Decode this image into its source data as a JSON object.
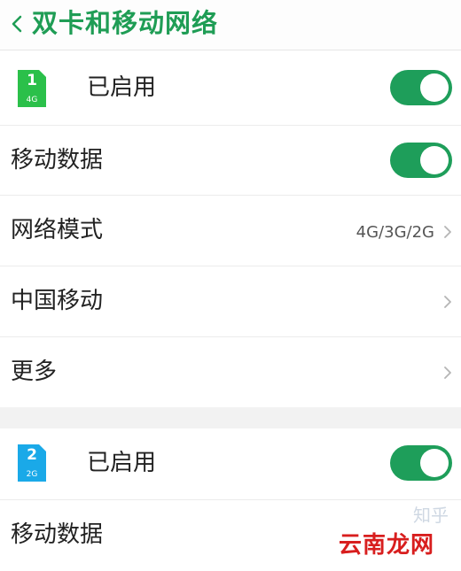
{
  "header": {
    "title": "双卡和移动网络"
  },
  "sim1": {
    "icon": {
      "number": "1",
      "network": "4G",
      "color": "#2bc04a"
    },
    "enabled_label": "已启用",
    "enabled": true,
    "mobile_data_label": "移动数据",
    "mobile_data": true,
    "network_mode_label": "网络模式",
    "network_mode_value": "4G/3G/2G",
    "carrier_label": "中国移动",
    "more_label": "更多"
  },
  "sim2": {
    "icon": {
      "number": "2",
      "network": "2G",
      "color": "#1aa9e8"
    },
    "enabled_label": "已启用",
    "enabled": true,
    "mobile_data_label": "移动数据"
  },
  "watermark": {
    "text": "云南龙网",
    "faint_text": "知乎"
  },
  "colors": {
    "accent": "#1f9d55",
    "toggle_on": "#1e9e5a"
  }
}
